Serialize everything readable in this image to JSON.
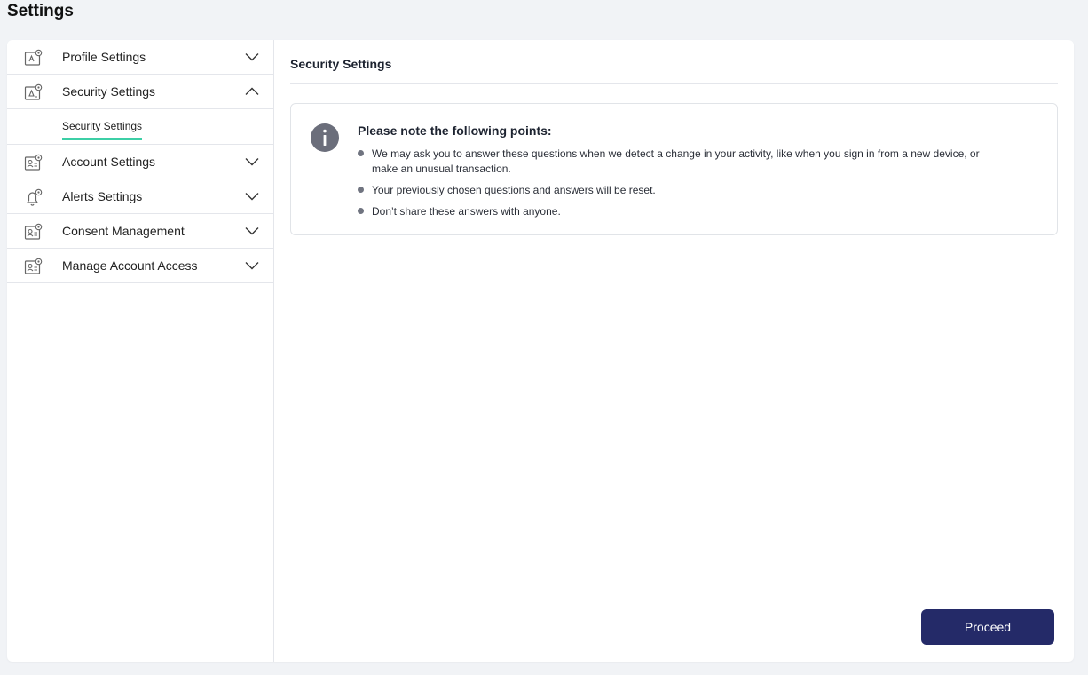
{
  "page": {
    "title": "Settings"
  },
  "sidebar": {
    "items": [
      {
        "label": "Profile Settings",
        "icon": "profile-settings-icon",
        "expanded": false
      },
      {
        "label": "Security Settings",
        "icon": "security-settings-icon",
        "expanded": true,
        "subitems": [
          {
            "label": "Security Settings",
            "active": true
          }
        ]
      },
      {
        "label": "Account Settings",
        "icon": "account-settings-icon",
        "expanded": false
      },
      {
        "label": "Alerts Settings",
        "icon": "bell-settings-icon",
        "expanded": false
      },
      {
        "label": "Consent Management",
        "icon": "consent-settings-icon",
        "expanded": false
      },
      {
        "label": "Manage Account Access",
        "icon": "account-access-icon",
        "expanded": false
      }
    ]
  },
  "main": {
    "title": "Security Settings",
    "note": {
      "heading": "Please note the following points:",
      "points": [
        "We may ask you to answer these questions when we detect a change in your activity, like when you sign in from a new device, or make an unusual transaction.",
        "Your previously chosen questions and answers will be reset.",
        "Don’t share these answers with anyone."
      ]
    },
    "proceed_label": "Proceed"
  },
  "colors": {
    "accent_underline": "#3ccfa6",
    "primary_button": "#242a68",
    "background": "#f1f3f6"
  }
}
